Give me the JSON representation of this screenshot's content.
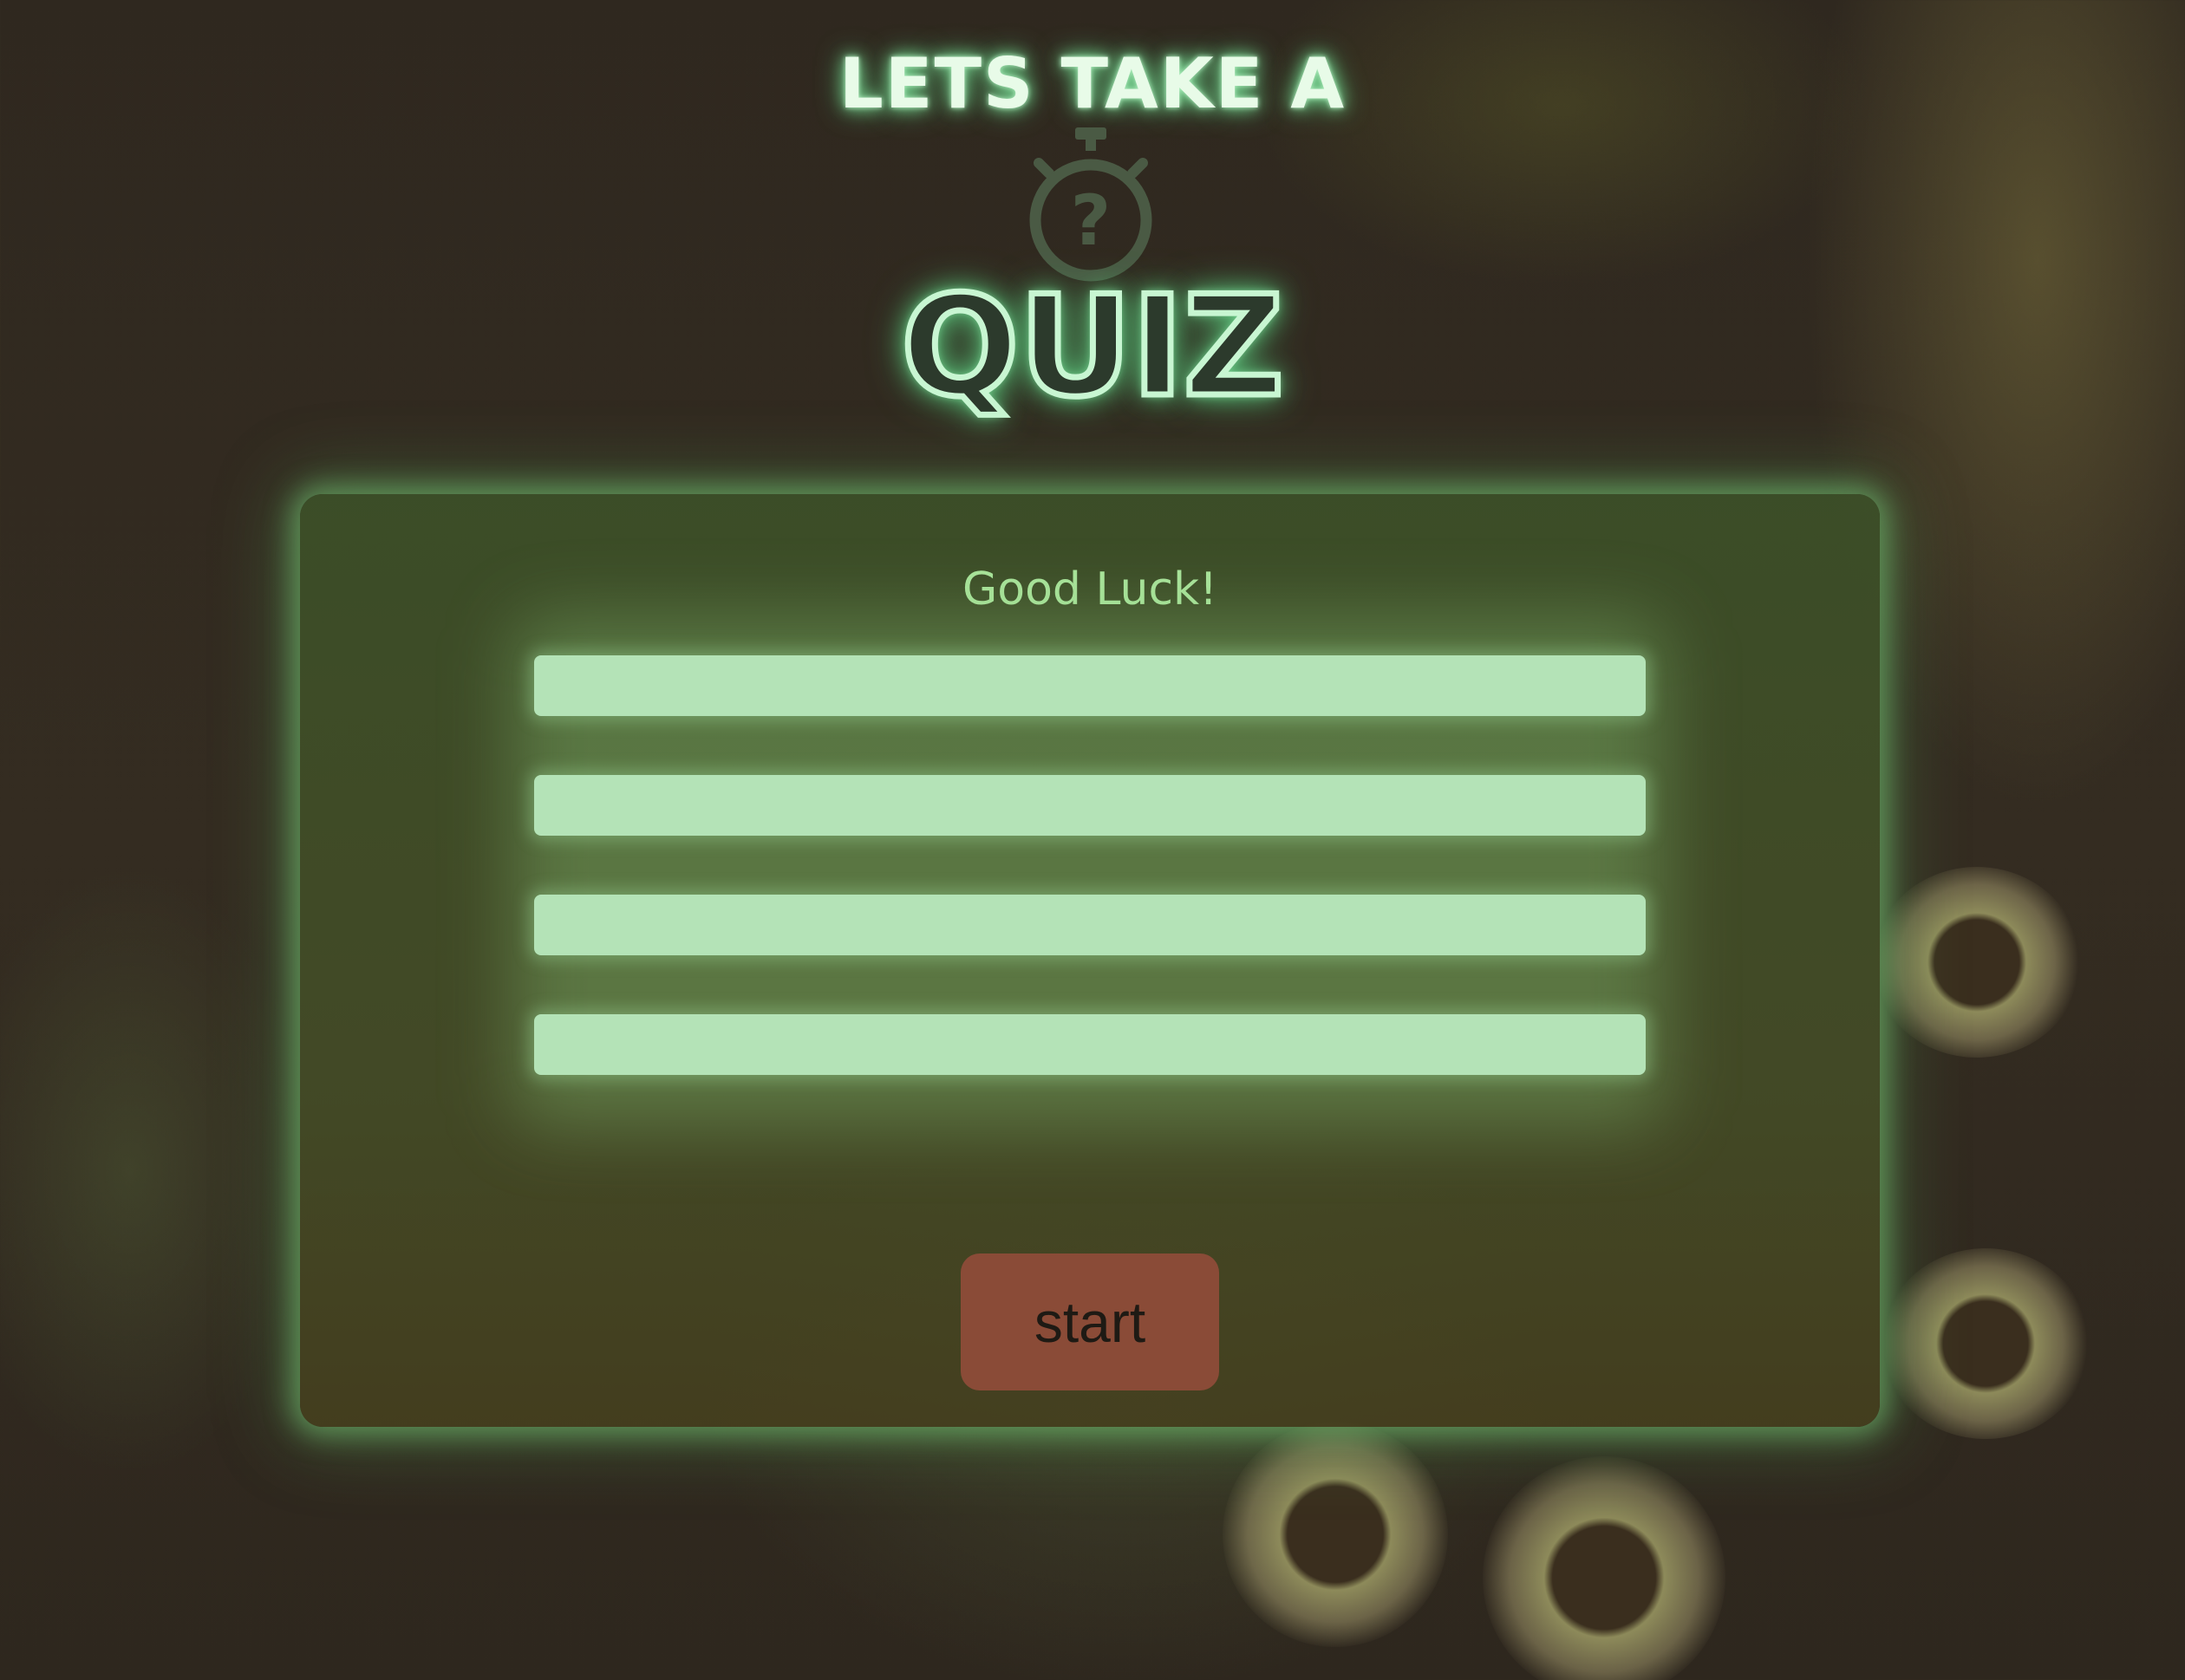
{
  "header": {
    "title_top": "LETS TAKE A",
    "title_main": "QUIZ",
    "icon": "stopwatch-question-icon"
  },
  "quiz": {
    "title": "Good Luck!",
    "answers": [
      "",
      "",
      "",
      ""
    ],
    "start_label": "start"
  },
  "colors": {
    "neon_text": "#e8fbe8",
    "neon_glow": "#7ddc97",
    "answer_bg": "#b4e3b7",
    "card_bg": "#3c5028",
    "start_bg": "#8a4b37",
    "heading_green": "#a8e39a"
  }
}
